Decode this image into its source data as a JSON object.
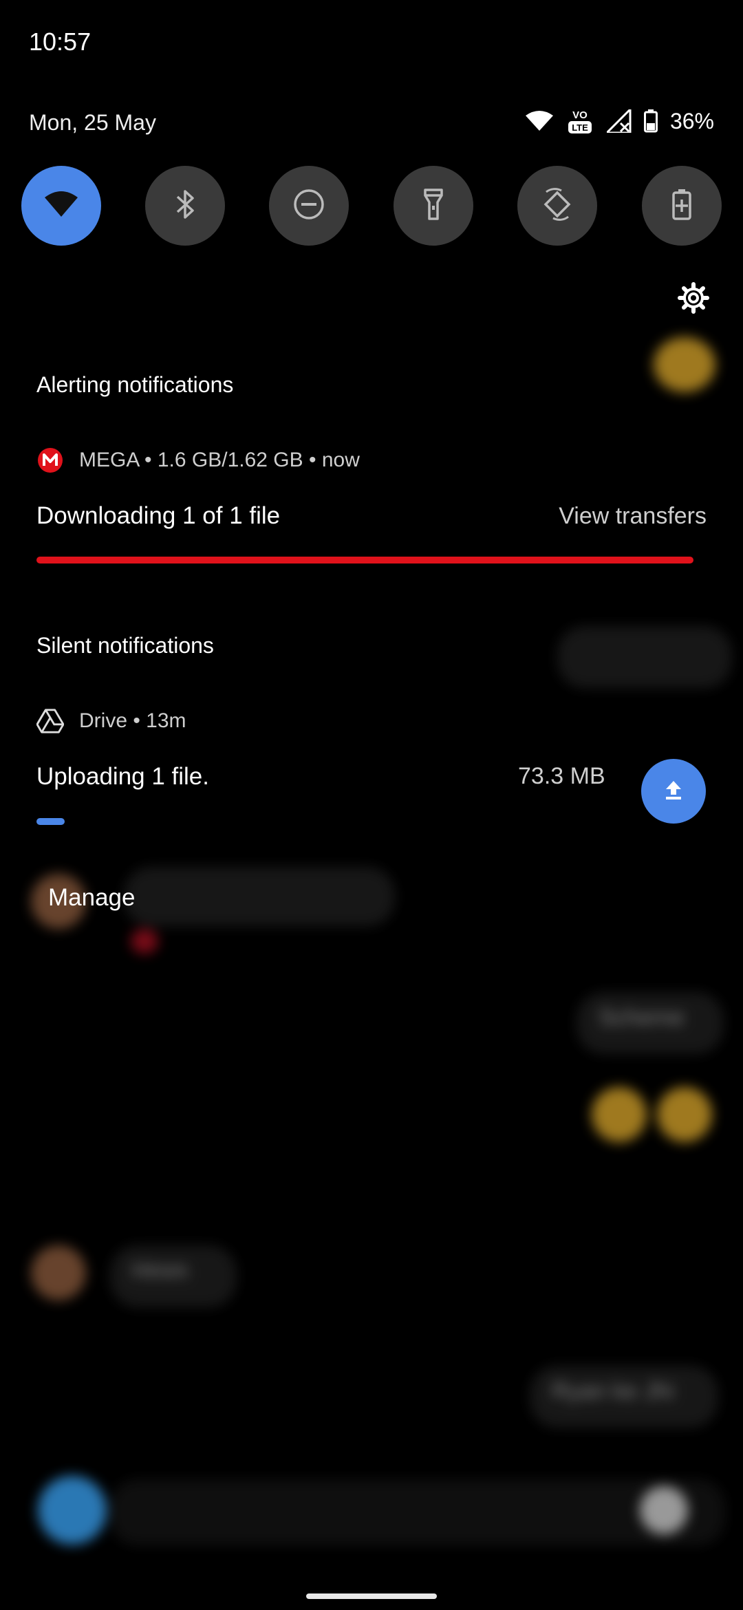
{
  "status_bar": {
    "time": "10:57",
    "date": "Mon, 25 May",
    "battery": "36%",
    "icons": [
      "wifi-icon",
      "volte-icon",
      "signal-icon",
      "battery-icon"
    ]
  },
  "quick_tiles": [
    {
      "name": "wifi-icon",
      "active": true
    },
    {
      "name": "bluetooth-icon",
      "active": false
    },
    {
      "name": "do-not-disturb-icon",
      "active": false
    },
    {
      "name": "flashlight-icon",
      "active": false
    },
    {
      "name": "auto-rotate-icon",
      "active": false
    },
    {
      "name": "battery-saver-icon",
      "active": false
    }
  ],
  "sections": {
    "alerting": "Alerting notifications",
    "silent": "Silent notifications"
  },
  "mega": {
    "app_info": "MEGA • 1.6 GB/1.62 GB • now",
    "title": "Downloading 1 of 1 file",
    "action": "View transfers",
    "progress": 0.99,
    "color": "#e0121b"
  },
  "drive": {
    "app_info": "Drive • 13m",
    "title": "Uploading 1 file.",
    "size": "73.3 MB",
    "progress": 0.05,
    "color": "#4a86e8"
  },
  "manage_label": "Manage",
  "background_app": {
    "bubbles": [
      "Scheme",
      "Hmm",
      "Ryan ke Jhi"
    ]
  }
}
